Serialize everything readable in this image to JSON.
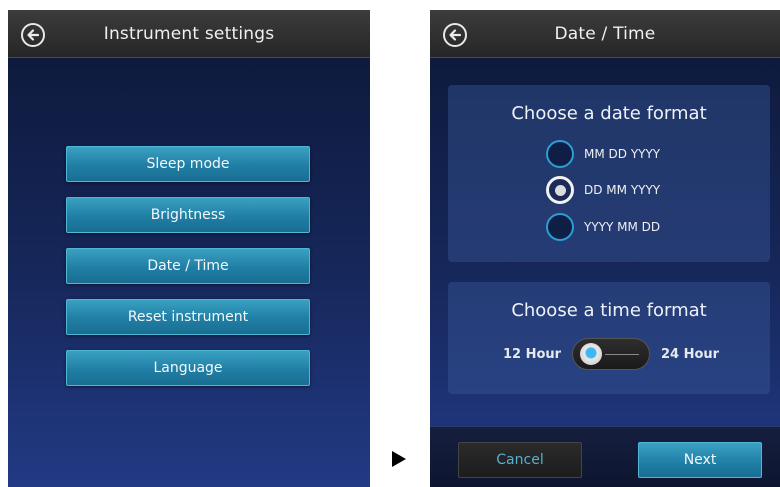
{
  "left_screen": {
    "title": "Instrument settings",
    "back_icon": "back-arrow-icon",
    "menu": [
      "Sleep mode",
      "Brightness",
      "Date / Time",
      "Reset instrument",
      "Language"
    ]
  },
  "transition_icon": "right-triangle-arrow-icon",
  "right_screen": {
    "title": "Date / Time",
    "back_icon": "back-arrow-icon",
    "date_panel": {
      "heading": "Choose a date format",
      "options": [
        "MM DD YYYY",
        "DD MM YYYY",
        "YYYY MM DD"
      ],
      "selected": "DD MM YYYY"
    },
    "time_panel": {
      "heading": "Choose a time format",
      "left_label": "12 Hour",
      "right_label": "24 Hour",
      "selected": "12 Hour"
    },
    "footer": {
      "cancel_label": "Cancel",
      "next_label": "Next"
    }
  },
  "colors": {
    "accent": "#2b9fd4",
    "button": "#207ea4",
    "titlebar": "#303030",
    "background": "#16275a"
  }
}
